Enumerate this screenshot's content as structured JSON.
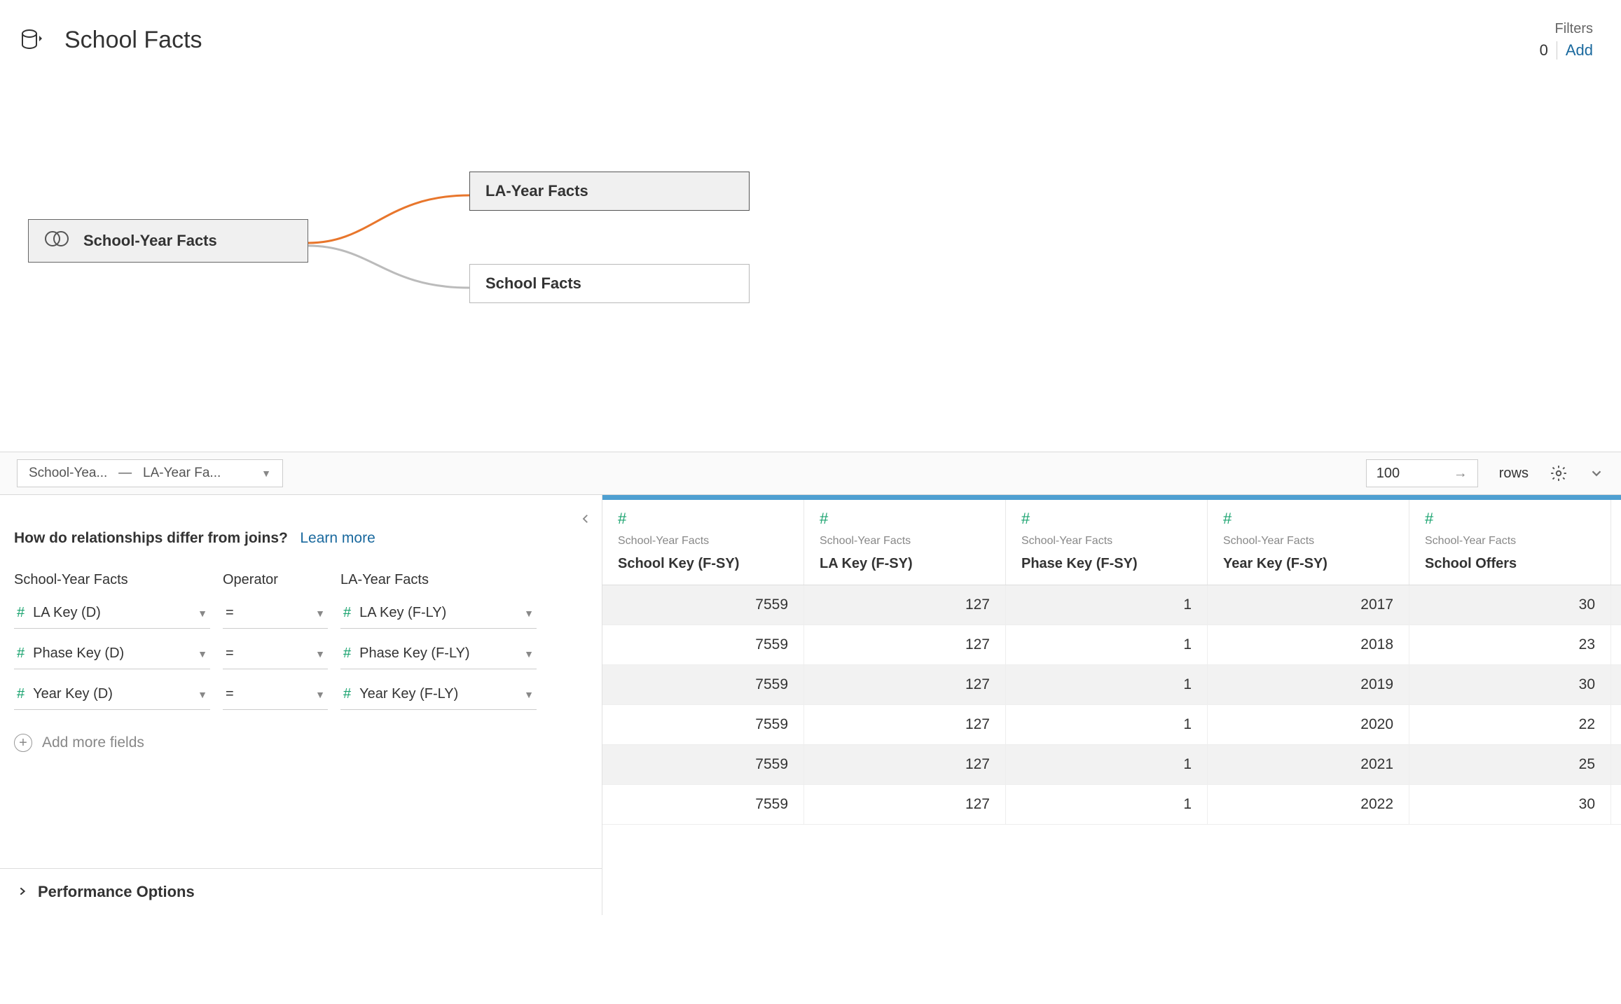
{
  "header": {
    "title": "School Facts",
    "filters_label": "Filters",
    "filters_count": "0",
    "add_label": "Add"
  },
  "canvas": {
    "root_table": "School-Year Facts",
    "child_tables": [
      "LA-Year Facts",
      "School Facts"
    ]
  },
  "midbar": {
    "rel_left": "School-Yea...",
    "rel_sep": "—",
    "rel_right": "LA-Year Fa...",
    "rows_value": "100",
    "rows_label": "rows"
  },
  "rel_panel": {
    "help_q": "How do relationships differ from joins?",
    "learn_more": "Learn more",
    "col_left": "School-Year Facts",
    "col_op": "Operator",
    "col_right": "LA-Year Facts",
    "rows": [
      {
        "left": "LA Key (D)",
        "op": "=",
        "right": "LA Key (F-LY)"
      },
      {
        "left": "Phase Key (D)",
        "op": "=",
        "right": "Phase Key (F-LY)"
      },
      {
        "left": "Year Key (D)",
        "op": "=",
        "right": "Year Key (F-LY)"
      }
    ],
    "add_more": "Add more fields",
    "perf_options": "Performance Options"
  },
  "grid": {
    "source": "School-Year Facts",
    "columns": [
      "School Key (F-SY)",
      "LA Key (F-SY)",
      "Phase Key (F-SY)",
      "Year Key (F-SY)",
      "School Offers"
    ],
    "rows": [
      [
        "7559",
        "127",
        "1",
        "2017",
        "30"
      ],
      [
        "7559",
        "127",
        "1",
        "2018",
        "23"
      ],
      [
        "7559",
        "127",
        "1",
        "2019",
        "30"
      ],
      [
        "7559",
        "127",
        "1",
        "2020",
        "22"
      ],
      [
        "7559",
        "127",
        "1",
        "2021",
        "25"
      ],
      [
        "7559",
        "127",
        "1",
        "2022",
        "30"
      ]
    ]
  }
}
